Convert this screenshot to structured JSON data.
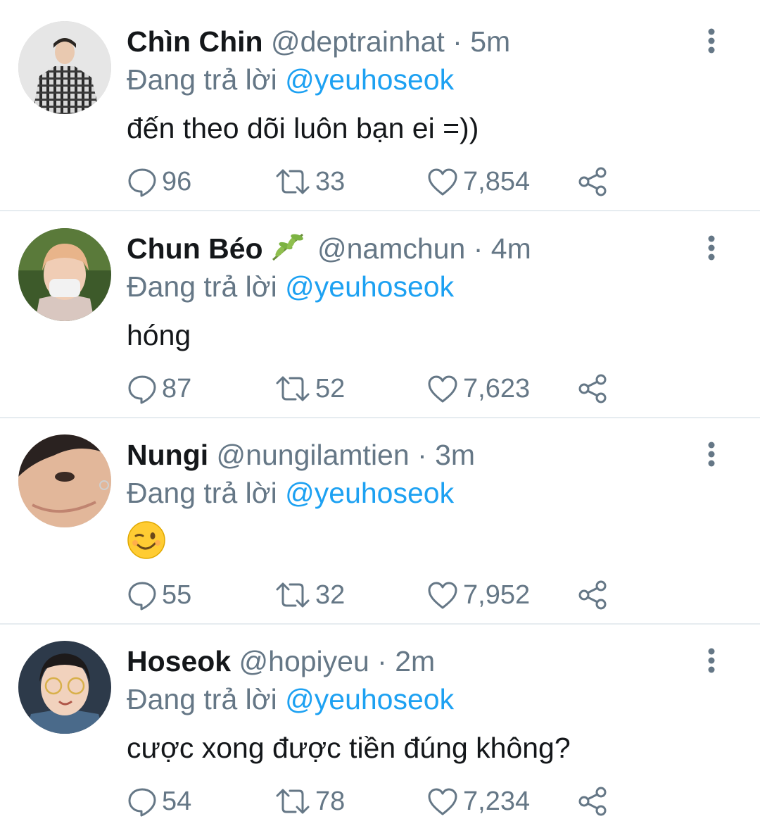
{
  "tweets": [
    {
      "name": "Chìn Chin",
      "handle": "@deptrainhat",
      "dot": "·",
      "time": "5m",
      "reply_prefix": "Đang trả lời",
      "reply_to": "@yeuhoseok",
      "text": "đến theo dõi luôn bạn ei =))",
      "replies": "96",
      "retweets": "33",
      "likes": "7,854",
      "avatar_icon": "avatar-plaid-coat"
    },
    {
      "name": "Chun Béo",
      "name_badge_icon": "leaf-icon",
      "handle": "@namchun",
      "dot": "·",
      "time": "4m",
      "reply_prefix": "Đang trả lời",
      "reply_to": "@yeuhoseok",
      "text": "hóng",
      "replies": "87",
      "retweets": "52",
      "likes": "7,623",
      "avatar_icon": "avatar-mask-blond"
    },
    {
      "name": "Nungi",
      "handle": "@nungilamtien",
      "dot": "·",
      "time": "3m",
      "reply_prefix": "Đang trả lời",
      "reply_to": "@yeuhoseok",
      "text": "",
      "emoji_icon": "winking-face-emoji",
      "replies": "55",
      "retweets": "32",
      "likes": "7,952",
      "avatar_icon": "avatar-face-closeup"
    },
    {
      "name": "Hoseok",
      "handle": "@hopiyeu",
      "dot": "·",
      "time": "2m",
      "reply_prefix": "Đang trả lời",
      "reply_to": "@yeuhoseok",
      "text": "cược xong được tiền đúng không?",
      "replies": "54",
      "retweets": "78",
      "likes": "7,234",
      "avatar_icon": "avatar-glasses-wink"
    }
  ],
  "colors": {
    "name": "#14171a",
    "secondary": "#657786",
    "link": "#1da1f2",
    "divider": "#e6ecf0"
  }
}
